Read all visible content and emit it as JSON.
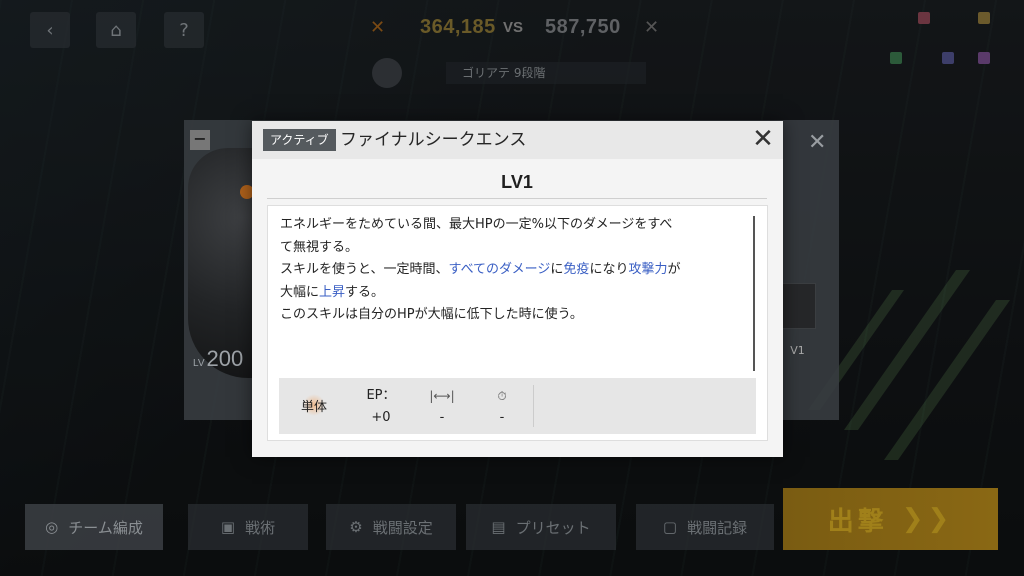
{
  "header": {
    "ally_power": "364,185",
    "vs_label": "VS",
    "enemy_power": "587,750",
    "enemy_name": "ゴリアテ 9段階"
  },
  "unit": {
    "level_prefix": "LV",
    "level": "200",
    "skill_level_badge": "V1"
  },
  "modal": {
    "tag": "アクティブ",
    "title": "ファイナルシークエンス",
    "level": "LV1",
    "description": {
      "line1": "エネルギーをためている間、最大HPの一定%以下のダメージをすべ",
      "line2": "て無視する。",
      "line3_a": "スキルを使うと、一定時間、",
      "line3_b": "すべてのダメージ",
      "line3_c": "に",
      "line3_d": "免疫",
      "line3_e": "になり",
      "line3_f": "攻撃力",
      "line3_g": "が",
      "line4_a": "大幅に",
      "line4_b": "上昇",
      "line4_c": "する。",
      "line5": "このスキルは自分のHPが大幅に低下した時に使う。"
    },
    "stats": {
      "target": "単体",
      "ep_label": "EP：",
      "ep_value": "+0",
      "range_value": "-",
      "cooldown_value": "-"
    },
    "highlight_color": "#3a5fc4"
  },
  "bottom_bar": {
    "team": "チーム編成",
    "tactics": "戦術",
    "battle_settings": "戦闘設定",
    "preset": "プリセット",
    "battle_record": "戦闘記録",
    "sortie": "出撃"
  },
  "icons": [
    "back-arrow-icon",
    "home-icon",
    "help-icon",
    "close-icon",
    "range-icon",
    "cooldown-icon"
  ]
}
